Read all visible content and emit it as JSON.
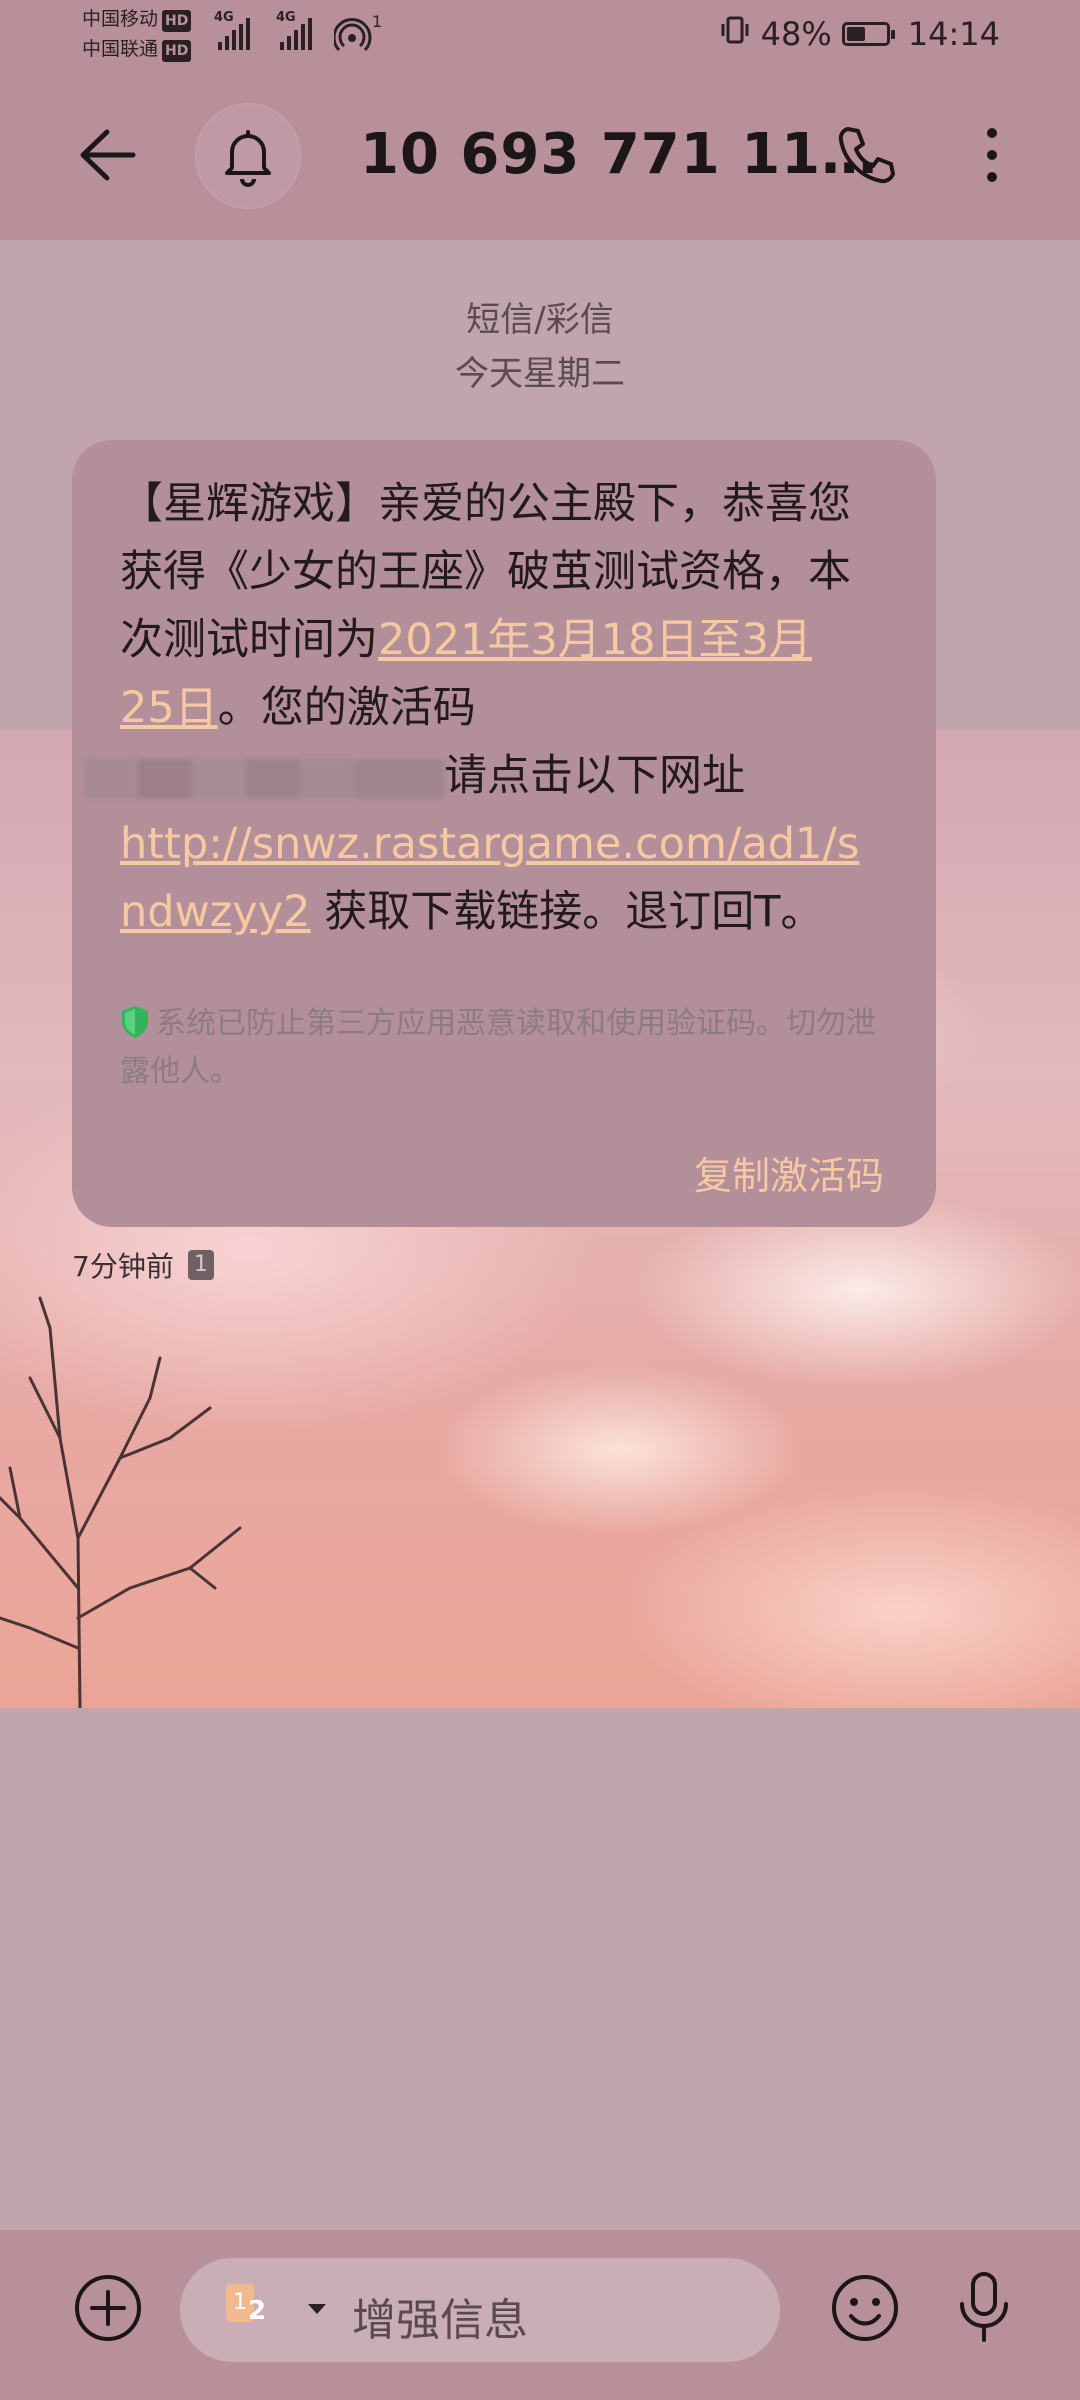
{
  "status_bar": {
    "carrier1": "中国移动",
    "carrier2": "中国联通",
    "hd_badge": "HD",
    "network": "4G",
    "hotspot_count": "1",
    "battery_percent": "48%",
    "battery_level": 0.48,
    "time": "14:14"
  },
  "header": {
    "title": "10 693 771 11…"
  },
  "conversation": {
    "type_label": "短信/彩信",
    "date_label": "今天星期二"
  },
  "message": {
    "part1": "【星辉游戏】亲爱的公主殿下，恭喜您获得《少女的王座》破茧测试资格，本次测试时间为",
    "date_link": "2021年3月18日至3月25日",
    "part2": "。您的激活码",
    "part3": "请点击以下网址",
    "url_link": "http://snwz.rastargame.com/ad1/sndwzyy2",
    "part4": " 获取下载链接。退订回T。",
    "security_note": "系统已防止第三方应用恶意读取和使用验证码。切勿泄露他人。",
    "copy_button": "复制激活码",
    "timestamp": "7分钟前",
    "sim_badge": "1"
  },
  "input_bar": {
    "sim_a": "1",
    "sim_b": "2",
    "placeholder": "增强信息"
  },
  "colors": {
    "bar_bg": "#b8909a",
    "bubble_bg": "#b38f99",
    "link": "#f7c9a3",
    "shield": "#33b35a"
  }
}
